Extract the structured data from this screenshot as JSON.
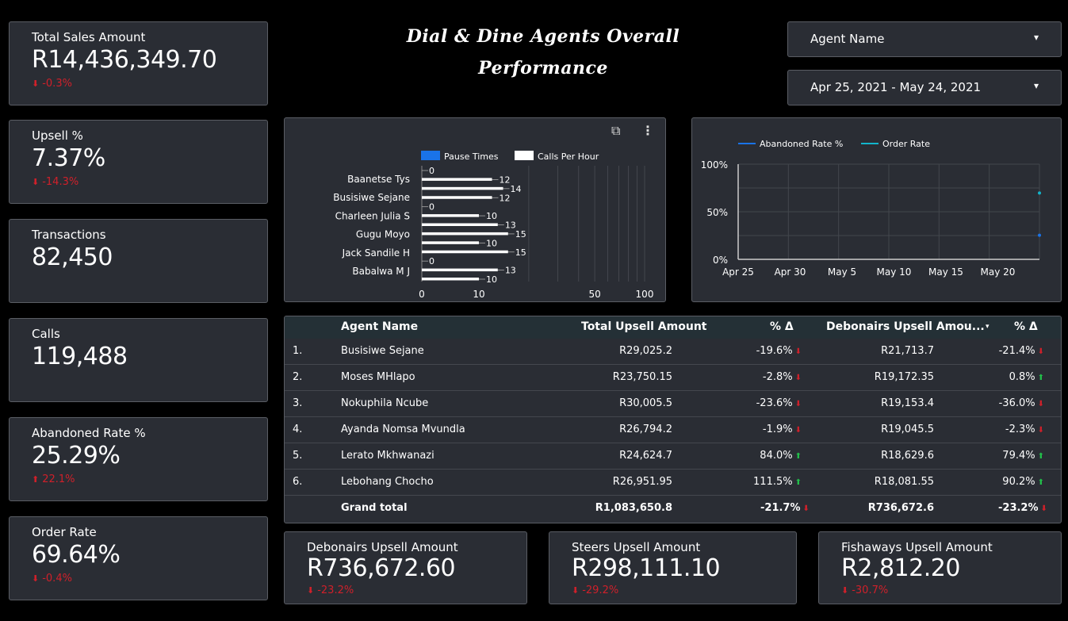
{
  "title": "Dial & Dine Agents Overall Performance",
  "kpis": {
    "total_sales": {
      "label": "Total Sales Amount",
      "value": "R14,436,349.70",
      "delta": "-0.3%"
    },
    "upsell": {
      "label": "Upsell %",
      "value": "7.37%",
      "delta": "-14.3%"
    },
    "transactions": {
      "label": "Transactions",
      "value": "82,450"
    },
    "calls": {
      "label": "Calls",
      "value": "119,488"
    },
    "abandoned": {
      "label": "Abandoned Rate %",
      "value": "25.29%",
      "delta": "22.1%"
    },
    "order_rate": {
      "label": "Order Rate",
      "value": "69.64%",
      "delta": "-0.4%"
    },
    "debonairs": {
      "label": "Debonairs Upsell Amount",
      "value": "R736,672.60",
      "delta": "-23.2%"
    },
    "steers": {
      "label": "Steers Upsell Amount",
      "value": "R298,111.10",
      "delta": "-29.2%"
    },
    "fishaways": {
      "label": "Fishaways Upsell Amount",
      "value": "R2,812.20",
      "delta": "-30.7%"
    }
  },
  "controls": {
    "agent_name": "Agent Name",
    "date_range": "Apr 25, 2021 - May 24, 2021"
  },
  "colors": {
    "accent_blue": "#1a73e8",
    "down_red": "#d0202a",
    "up_green": "#22c04a",
    "cyan": "#12b5cb"
  },
  "chart_data": [
    {
      "type": "bar",
      "orientation": "horizontal",
      "legend": [
        "Pause Times",
        "Calls Per Hour"
      ],
      "categories": [
        "Baanetse Tys",
        "Busisiwe Sejane",
        "Charleen Julia S",
        "Gugu Moyo",
        "Jack Sandile H",
        "Babalwa M J"
      ],
      "bar_labels": [
        "0",
        "12",
        "14",
        "12",
        "0",
        "10",
        "13",
        "15",
        "10",
        "15",
        "0",
        "13",
        "10"
      ],
      "bar_values": [
        0,
        12,
        14,
        12,
        0,
        10,
        13,
        15,
        10,
        15,
        0,
        13,
        10
      ],
      "xticks": [
        "0",
        "10",
        "50",
        "100"
      ],
      "xscale": "log"
    },
    {
      "type": "line",
      "legend": [
        "Abandoned Rate %",
        "Order Rate"
      ],
      "xticks": [
        "Apr 25",
        "Apr 30",
        "May 5",
        "May 10",
        "May 15",
        "May 20"
      ],
      "yticks": [
        "100%",
        "50%",
        "0%"
      ],
      "ylim": [
        0,
        100
      ],
      "series": [
        {
          "name": "Abandoned Rate %",
          "points": [
            {
              "x": "May 24",
              "y": 25.29
            }
          ]
        },
        {
          "name": "Order Rate",
          "points": [
            {
              "x": "May 24",
              "y": 69.64
            }
          ]
        }
      ]
    }
  ],
  "table": {
    "headers": [
      "Agent Name",
      "Total Upsell Amount",
      "% Δ",
      "Debonairs Upsell Amou...",
      "% Δ"
    ],
    "rows": [
      {
        "num": "1.",
        "name": "Busisiwe Sejane",
        "total": "R29,025.2",
        "pct": "-19.6%",
        "deb": "R21,713.7",
        "pct2": "-21.4%",
        "dir1": "down",
        "dir2": "down"
      },
      {
        "num": "2.",
        "name": "Moses MHlapo",
        "total": "R23,750.15",
        "pct": "-2.8%",
        "deb": "R19,172.35",
        "pct2": "0.8%",
        "dir1": "down",
        "dir2": "up"
      },
      {
        "num": "3.",
        "name": "Nokuphila Ncube",
        "total": "R30,005.5",
        "pct": "-23.6%",
        "deb": "R19,153.4",
        "pct2": "-36.0%",
        "dir1": "down",
        "dir2": "down"
      },
      {
        "num": "4.",
        "name": "Ayanda Nomsa Mvundla",
        "total": "R26,794.2",
        "pct": "-1.9%",
        "deb": "R19,045.5",
        "pct2": "-2.3%",
        "dir1": "down",
        "dir2": "down"
      },
      {
        "num": "5.",
        "name": "Lerato Mkhwanazi",
        "total": "R24,624.7",
        "pct": "84.0%",
        "deb": "R18,629.6",
        "pct2": "79.4%",
        "dir1": "up",
        "dir2": "up"
      },
      {
        "num": "6.",
        "name": "Lebohang Chocho",
        "total": "R26,951.95",
        "pct": "111.5%",
        "deb": "R18,081.55",
        "pct2": "90.2%",
        "dir1": "up",
        "dir2": "up"
      }
    ],
    "total": {
      "name": "Grand total",
      "total": "R1,083,650.8",
      "pct": "-21.7%",
      "deb": "R736,672.6",
      "pct2": "-23.2%"
    }
  }
}
